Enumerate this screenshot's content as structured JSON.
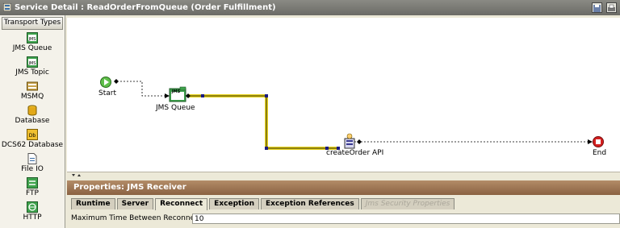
{
  "window": {
    "title": "Service Detail : ReadOrderFromQueue (Order Fulfillment)"
  },
  "sidebar": {
    "header": "Transport Types",
    "items": [
      {
        "label": "JMS Queue",
        "icon": "jms-queue-icon"
      },
      {
        "label": "JMS Topic",
        "icon": "jms-topic-icon"
      },
      {
        "label": "MSMQ",
        "icon": "msmq-icon"
      },
      {
        "label": "Database",
        "icon": "database-icon"
      },
      {
        "label": "DCS62 Database",
        "icon": "dcs62-database-icon"
      },
      {
        "label": "File IO",
        "icon": "file-io-icon"
      },
      {
        "label": "FTP",
        "icon": "ftp-icon"
      },
      {
        "label": "HTTP",
        "icon": "http-icon"
      }
    ]
  },
  "canvas": {
    "nodes": {
      "start": "Start",
      "jms_queue": "JMS Queue",
      "jms_badge": "JMS",
      "create_order": "createOrder API",
      "end": "End"
    },
    "colors": {
      "highlight_link": "#e6d21e",
      "start": "#5fbf4a",
      "end": "#d42020",
      "link": "#000000"
    }
  },
  "properties": {
    "title": "Properties: JMS Receiver",
    "tabs": [
      {
        "label": "Runtime",
        "active": false
      },
      {
        "label": "Server",
        "active": false
      },
      {
        "label": "Reconnect",
        "active": true
      },
      {
        "label": "Exception",
        "active": false
      },
      {
        "label": "Exception References",
        "active": false
      },
      {
        "label": "Jms Security Properties",
        "active": false,
        "disabled": true
      }
    ],
    "field": {
      "label": "Maximum Time Between Reconnects (min)",
      "value": "10"
    }
  }
}
